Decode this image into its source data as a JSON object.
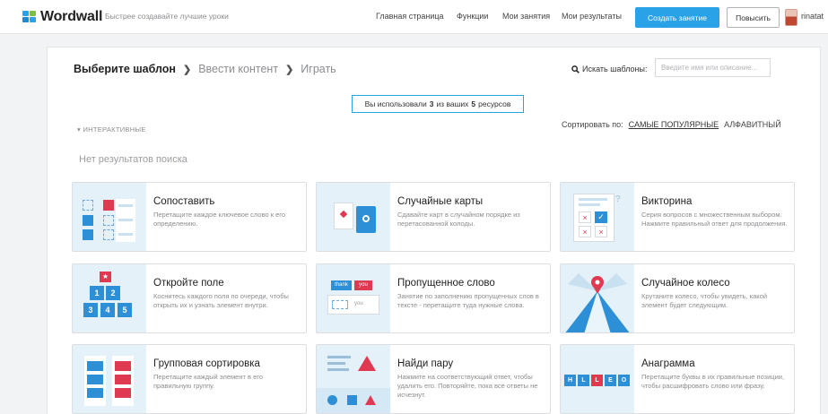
{
  "header": {
    "logo_text": "Wordwall",
    "tagline": "Быстрее создавайте лучшие уроки",
    "nav": [
      "Главная страница",
      "Функции",
      "Мои занятия",
      "Мои результаты"
    ],
    "create_button": "Создать занятие",
    "upgrade_button": "Повысить",
    "username": "rinatat",
    "brand_color": "#2aa2e8"
  },
  "main": {
    "breadcrumb": {
      "step1": "Выберите шаблон",
      "step2": "Ввести контент",
      "step3": "Играть"
    },
    "search": {
      "label": "Искать шаблоны:",
      "placeholder": "Введите имя или описание..."
    },
    "usage": {
      "prefix": "Вы использовали",
      "used": "3",
      "middle": "из ваших",
      "total": "5",
      "suffix": "ресурсов"
    },
    "section_label": "ИНТЕРАКТИВНЫЕ",
    "sort": {
      "label": "Сортировать по:",
      "popular": "САМЫЕ ПОПУЛЯРНЫЕ",
      "alpha": "АЛФАВИТНЫЙ"
    },
    "no_results": "Нет результатов поиска",
    "templates": [
      {
        "title": "Сопоставить",
        "desc": "Перетащите каждое ключевое слово к его определению."
      },
      {
        "title": "Случайные карты",
        "desc": "Сдавайте карт в случайном порядке из перетасованной колоды."
      },
      {
        "title": "Викторина",
        "desc": "Серия вопросов с множественным выбором. Нажмите правильный ответ для продолжения."
      },
      {
        "title": "Откройте поле",
        "desc": "Коснитесь каждого поля по очереди, чтобы открыть их и узнать элемент внутри."
      },
      {
        "title": "Пропущенное слово",
        "desc": "Занятие по заполнению пропущенных слов в тексте - перетащите туда нужные слова."
      },
      {
        "title": "Случайное колесо",
        "desc": "Крутаните колесо, чтобы увидеть, какой элемент будет следующим."
      },
      {
        "title": "Групповая сортировка",
        "desc": "Перетащите каждый элемент в его правильную группу."
      },
      {
        "title": "Найди пару",
        "desc": "Нажмите на соответствующий ответ, чтобы удалить его. Повторяйте, пока все ответы не исчезнут."
      },
      {
        "title": "Анаграмма",
        "desc": "Перетащите буквы в их правильные позиции, чтобы расшифровать слово или фразу."
      }
    ],
    "thumb_labels": {
      "open_box": [
        "1",
        "2",
        "3",
        "4",
        "5"
      ],
      "missing_word": [
        "thank",
        "you",
        "you"
      ],
      "anagram": [
        "H",
        "L",
        "L",
        "E",
        "O"
      ]
    }
  }
}
